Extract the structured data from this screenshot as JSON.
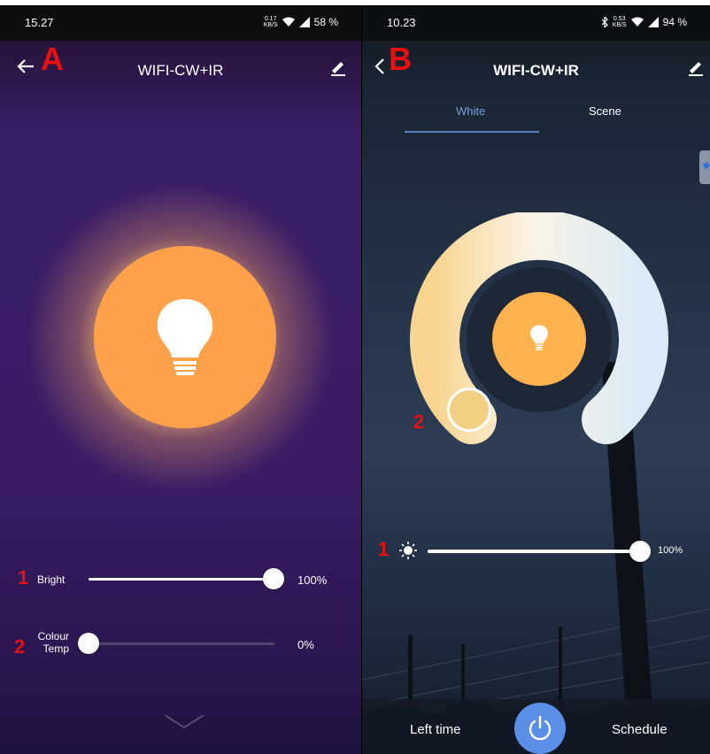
{
  "panel_a": {
    "marker": "A",
    "status": {
      "time": "15.27",
      "speed_top": "0.17",
      "speed_bottom": "KB/S",
      "battery": "58 %"
    },
    "header": {
      "title": "WIFI-CW+IR"
    },
    "bright": {
      "marker": "1",
      "label": "Bright",
      "percent": "100%",
      "value": 1.0
    },
    "colour_temp": {
      "marker": "2",
      "label_line1": "Colour",
      "label_line2": "Temp",
      "percent": "0%",
      "value": 0.0
    },
    "icons": [
      "back-arrow-icon",
      "edit-pencil-icon",
      "lightbulb-icon",
      "chevron-down-icon"
    ]
  },
  "panel_b": {
    "marker": "B",
    "status": {
      "time": "10.23",
      "speed_top": "0.53",
      "speed_bottom": "KB/S",
      "battery": "94 %"
    },
    "header": {
      "title": "WIFI-CW+IR"
    },
    "tabs": [
      {
        "label": "White",
        "active": true
      },
      {
        "label": "Scene",
        "active": false
      }
    ],
    "colour_ring": {
      "marker": "2"
    },
    "brightness": {
      "marker": "1",
      "percent": "100%",
      "value": 1.0
    },
    "bottom": {
      "left_time": "Left time",
      "schedule": "Schedule"
    },
    "icons": [
      "back-chevron-icon",
      "edit-pencil-icon",
      "lightbulb-icon",
      "sun-icon",
      "power-icon"
    ]
  },
  "colors": {
    "accent_orange": "#ffa14a",
    "tab_active": "#7c9fd6",
    "power_blue": "#5b8ee6",
    "marker_red": "#e81010"
  }
}
